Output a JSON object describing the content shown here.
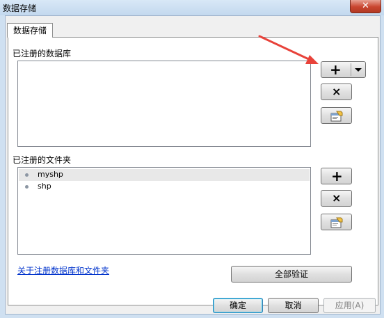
{
  "window": {
    "title": "数据存储",
    "close_glyph": "✕"
  },
  "tab": {
    "label": "数据存储"
  },
  "databases": {
    "label": "已注册的数据库",
    "items": []
  },
  "folders": {
    "label": "已注册的文件夹",
    "items": [
      {
        "label": "myshp",
        "selected": true
      },
      {
        "label": "shp",
        "selected": false
      }
    ]
  },
  "buttons": {
    "add": "+",
    "remove": "×",
    "validate_all": "全部验证",
    "ok": "确定",
    "cancel": "取消",
    "apply": "应用(A)"
  },
  "link": {
    "text": "关于注册数据库和文件夹"
  },
  "colors": {
    "annotation_arrow": "#e8423a",
    "link": "#0033cc"
  },
  "icons": [
    "close-icon",
    "add-icon",
    "dropdown-arrow-icon",
    "remove-icon",
    "properties-icon",
    "bullet-icon"
  ]
}
